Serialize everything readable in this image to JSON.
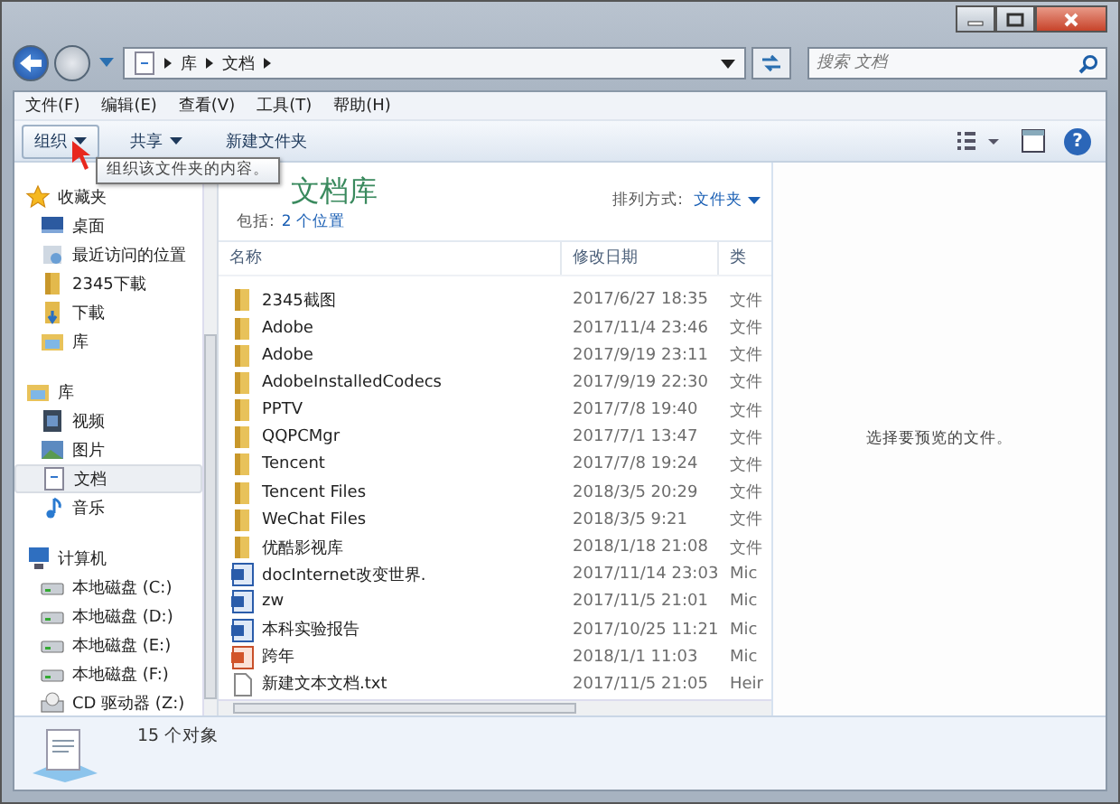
{
  "help": "?",
  "address": {
    "path": [
      "库",
      "文档"
    ],
    "search_placeholder": "搜索 文档"
  },
  "menu": [
    "文件(F)",
    "编辑(E)",
    "查看(V)",
    "工具(T)",
    "帮助(H)"
  ],
  "toolbar": {
    "buttons": [
      {
        "label": "组织",
        "dropdown": true
      },
      {
        "label": "共享",
        "dropdown": true
      },
      {
        "label": "新建文件夹",
        "dropdown": false
      }
    ]
  },
  "tooltip": "组织该文件夹的内容。",
  "sidebar": {
    "groups": [
      {
        "label": "收藏夹",
        "kind": "star",
        "children": [
          {
            "label": "桌面",
            "kind": "desktop",
            "selected": false
          },
          {
            "label": "最近访问的位置",
            "kind": "recent",
            "selected": false
          },
          {
            "label": "2345下載",
            "kind": "folder",
            "selected": false
          },
          {
            "label": "下載",
            "kind": "download",
            "selected": false
          },
          {
            "label": "库",
            "kind": "library",
            "selected": false
          }
        ]
      },
      {
        "label": "库",
        "kind": "library",
        "children": [
          {
            "label": "视频",
            "kind": "video",
            "selected": false
          },
          {
            "label": "图片",
            "kind": "picture",
            "selected": false
          },
          {
            "label": "文档",
            "kind": "doc",
            "selected": true
          },
          {
            "label": "音乐",
            "kind": "music",
            "selected": false
          }
        ]
      },
      {
        "label": "计算机",
        "kind": "computer",
        "children": [
          {
            "label": "本地磁盘 (C:)",
            "kind": "drive",
            "selected": false
          },
          {
            "label": "本地磁盘 (D:)",
            "kind": "drive",
            "selected": false
          },
          {
            "label": "本地磁盘 (E:)",
            "kind": "drive",
            "selected": false
          },
          {
            "label": "本地磁盘 (F:)",
            "kind": "drive",
            "selected": false
          },
          {
            "label": "CD 驱动器 (Z:)",
            "kind": "cd",
            "selected": false
          }
        ]
      }
    ]
  },
  "library": {
    "title": "文档库",
    "includes_label": "包括:",
    "includes_link": "2 个位置",
    "arrange_label": "排列方式:",
    "arrange_value": "文件夹"
  },
  "table": {
    "columns": [
      "名称",
      "修改日期",
      "类"
    ],
    "rows": [
      {
        "kind": "folder",
        "name": "2345截图",
        "date": "2017/6/27 18:35",
        "type": "文件"
      },
      {
        "kind": "folder",
        "name": "Adobe",
        "date": "2017/11/4 23:46",
        "type": "文件"
      },
      {
        "kind": "folder",
        "name": "Adobe",
        "date": "2017/9/19 23:11",
        "type": "文件"
      },
      {
        "kind": "folder",
        "name": "AdobeInstalledCodecs",
        "date": "2017/9/19 22:30",
        "type": "文件"
      },
      {
        "kind": "folder",
        "name": "PPTV",
        "date": "2017/7/8 19:40",
        "type": "文件"
      },
      {
        "kind": "folder",
        "name": "QQPCMgr",
        "date": "2017/7/1 13:47",
        "type": "文件"
      },
      {
        "kind": "folder",
        "name": "Tencent",
        "date": "2017/7/8 19:24",
        "type": "文件"
      },
      {
        "kind": "folder",
        "name": "Tencent Files",
        "date": "2018/3/5 20:29",
        "type": "文件"
      },
      {
        "kind": "folder",
        "name": "WeChat Files",
        "date": "2018/3/5 9:21",
        "type": "文件"
      },
      {
        "kind": "folder",
        "name": "优酷影视库",
        "date": "2018/1/18 21:08",
        "type": "文件"
      },
      {
        "kind": "word",
        "name": "docInternet改变世界.",
        "date": "2017/11/14 23:03",
        "type": "Mic"
      },
      {
        "kind": "word",
        "name": "zw",
        "date": "2017/11/5 21:01",
        "type": "Mic"
      },
      {
        "kind": "word",
        "name": "本科实验报告",
        "date": "2017/10/25 11:21",
        "type": "Mic"
      },
      {
        "kind": "ppt",
        "name": "跨年",
        "date": "2018/1/1 11:03",
        "type": "Mic"
      },
      {
        "kind": "txt",
        "name": "新建文本文档.txt",
        "date": "2017/11/5 21:05",
        "type": "Heir"
      }
    ]
  },
  "preview": {
    "message": "选择要预览的文件。"
  },
  "status_bar": {
    "count": "15 个对象"
  }
}
